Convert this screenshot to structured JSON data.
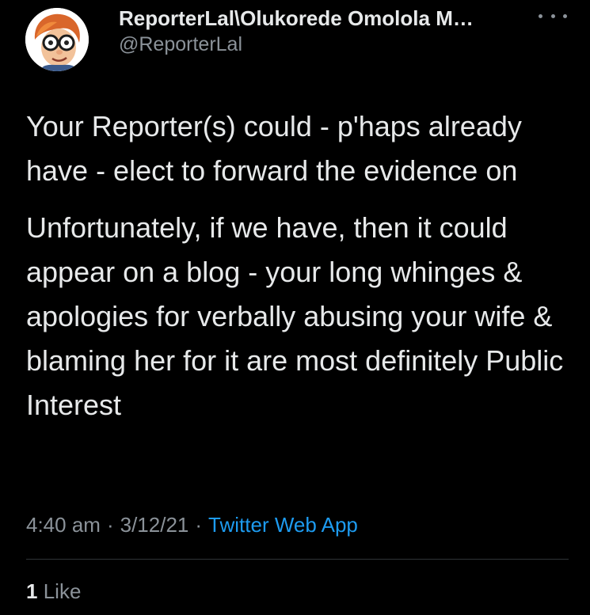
{
  "colors": {
    "background": "#000000",
    "primary_text": "#e7e9ea",
    "secondary_text": "#8b9299",
    "link": "#1d9bf0",
    "divider": "#2f3336"
  },
  "author": {
    "display_name": "ReporterLal\\Olukorede Omolola M…",
    "handle": "@ReporterLal",
    "avatar_icon": "cartoon-reporter-with-glasses"
  },
  "more_icon": "more-horizontal-icon",
  "tweet": {
    "paragraphs": [
      "Your Reporter(s) could - p'haps already have - elect to forward the evidence on",
      "Unfortunately, if we have, then it could appear on a blog - your long whinges & apologies for verbally abusing your wife & blaming her for it are most definitely Public Interest"
    ],
    "time": "4:40 am",
    "date": "3/12/21",
    "separator": "·",
    "source": "Twitter Web App"
  },
  "stats": {
    "likes_count": "1",
    "likes_label": "Like"
  }
}
